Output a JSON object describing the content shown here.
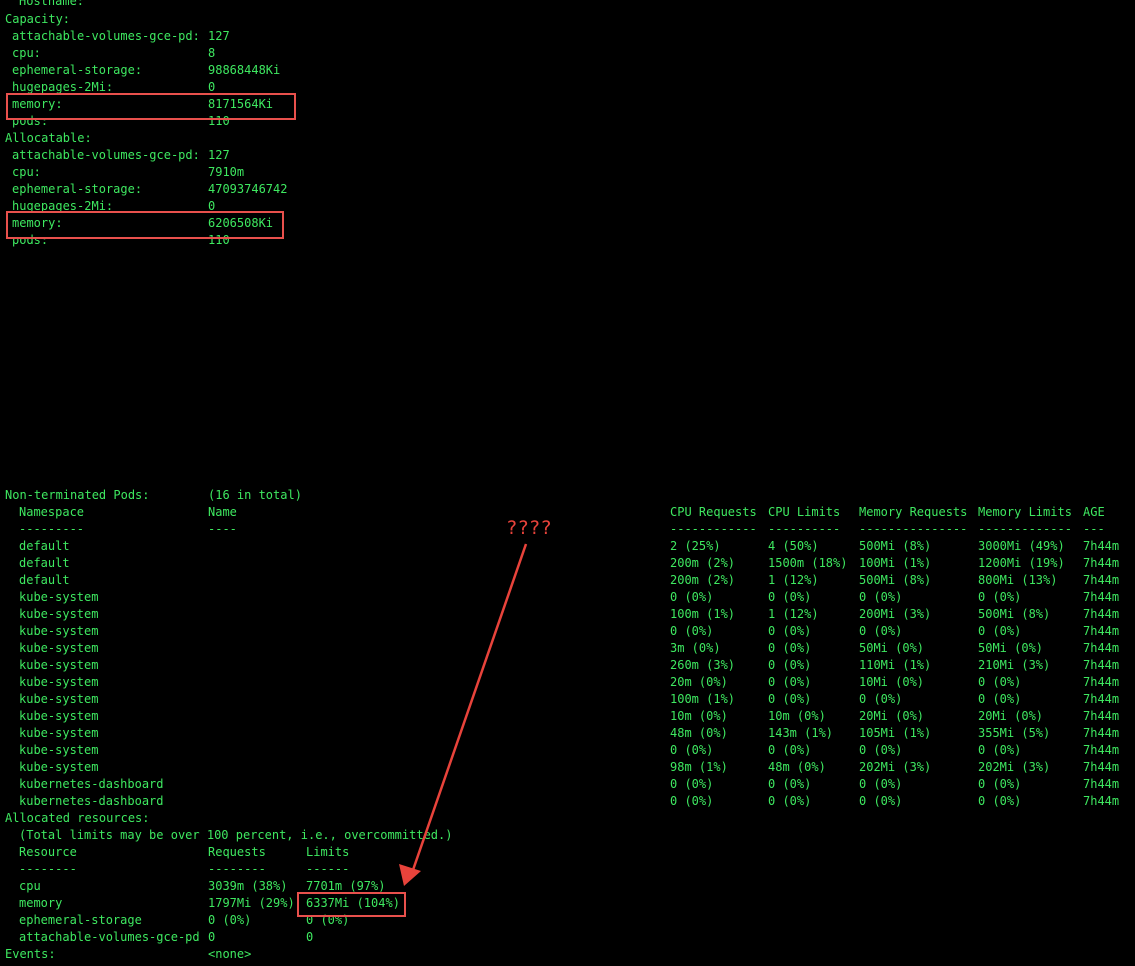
{
  "node": {
    "hostname_label": "Hostname:",
    "capacity": {
      "label": "Capacity:",
      "rows": [
        {
          "key": "attachable-volumes-gce-pd:",
          "value": "127"
        },
        {
          "key": "cpu:",
          "value": "8"
        },
        {
          "key": "ephemeral-storage:",
          "value": "98868448Ki"
        },
        {
          "key": "hugepages-2Mi:",
          "value": "0"
        },
        {
          "key": "memory:",
          "value": "8171564Ki"
        },
        {
          "key": "pods:",
          "value": "110"
        }
      ]
    },
    "allocatable": {
      "label": "Allocatable:",
      "rows": [
        {
          "key": "attachable-volumes-gce-pd:",
          "value": "127"
        },
        {
          "key": "cpu:",
          "value": "7910m"
        },
        {
          "key": "ephemeral-storage:",
          "value": "47093746742"
        },
        {
          "key": "hugepages-2Mi:",
          "value": "0"
        },
        {
          "key": "memory:",
          "value": "6206508Ki"
        },
        {
          "key": "pods:",
          "value": "110"
        }
      ]
    }
  },
  "pods": {
    "label": "Non-terminated Pods:",
    "total": "(16 in total)",
    "columns": {
      "namespace": "Namespace",
      "namespace_rule": "---------",
      "name": "Name",
      "name_rule": "----",
      "cpu_req": "CPU Requests",
      "cpu_req_rule": "------------",
      "cpu_lim": "CPU Limits",
      "cpu_lim_rule": "----------",
      "mem_req": "Memory Requests",
      "mem_req_rule": "---------------",
      "mem_lim": "Memory Limits",
      "mem_lim_rule": "-------------",
      "age": "AGE",
      "age_rule": "---"
    },
    "rows": [
      {
        "ns": "default",
        "cpu_req": "2 (25%)",
        "cpu_lim": "4 (50%)",
        "mem_req": "500Mi (8%)",
        "mem_lim": "3000Mi (49%)",
        "age": "7h44m"
      },
      {
        "ns": "default",
        "cpu_req": "200m (2%)",
        "cpu_lim": "1500m (18%)",
        "mem_req": "100Mi (1%)",
        "mem_lim": "1200Mi (19%)",
        "age": "7h44m"
      },
      {
        "ns": "default",
        "cpu_req": "200m (2%)",
        "cpu_lim": "1 (12%)",
        "mem_req": "500Mi (8%)",
        "mem_lim": "800Mi (13%)",
        "age": "7h44m"
      },
      {
        "ns": "kube-system",
        "cpu_req": "0 (0%)",
        "cpu_lim": "0 (0%)",
        "mem_req": "0 (0%)",
        "mem_lim": "0 (0%)",
        "age": "7h44m"
      },
      {
        "ns": "kube-system",
        "cpu_req": "100m (1%)",
        "cpu_lim": "1 (12%)",
        "mem_req": "200Mi (3%)",
        "mem_lim": "500Mi (8%)",
        "age": "7h44m"
      },
      {
        "ns": "kube-system",
        "cpu_req": "0 (0%)",
        "cpu_lim": "0 (0%)",
        "mem_req": "0 (0%)",
        "mem_lim": "0 (0%)",
        "age": "7h44m"
      },
      {
        "ns": "kube-system",
        "cpu_req": "3m (0%)",
        "cpu_lim": "0 (0%)",
        "mem_req": "50Mi (0%)",
        "mem_lim": "50Mi (0%)",
        "age": "7h44m"
      },
      {
        "ns": "kube-system",
        "cpu_req": "260m (3%)",
        "cpu_lim": "0 (0%)",
        "mem_req": "110Mi (1%)",
        "mem_lim": "210Mi (3%)",
        "age": "7h44m"
      },
      {
        "ns": "kube-system",
        "cpu_req": "20m (0%)",
        "cpu_lim": "0 (0%)",
        "mem_req": "10Mi (0%)",
        "mem_lim": "0 (0%)",
        "age": "7h44m"
      },
      {
        "ns": "kube-system",
        "cpu_req": "100m (1%)",
        "cpu_lim": "0 (0%)",
        "mem_req": "0 (0%)",
        "mem_lim": "0 (0%)",
        "age": "7h44m"
      },
      {
        "ns": "kube-system",
        "cpu_req": "10m (0%)",
        "cpu_lim": "10m (0%)",
        "mem_req": "20Mi (0%)",
        "mem_lim": "20Mi (0%)",
        "age": "7h44m"
      },
      {
        "ns": "kube-system",
        "cpu_req": "48m (0%)",
        "cpu_lim": "143m (1%)",
        "mem_req": "105Mi (1%)",
        "mem_lim": "355Mi (5%)",
        "age": "7h44m"
      },
      {
        "ns": "kube-system",
        "cpu_req": "0 (0%)",
        "cpu_lim": "0 (0%)",
        "mem_req": "0 (0%)",
        "mem_lim": "0 (0%)",
        "age": "7h44m"
      },
      {
        "ns": "kube-system",
        "cpu_req": "98m (1%)",
        "cpu_lim": "48m (0%)",
        "mem_req": "202Mi (3%)",
        "mem_lim": "202Mi (3%)",
        "age": "7h44m"
      },
      {
        "ns": "kubernetes-dashboard",
        "cpu_req": "0 (0%)",
        "cpu_lim": "0 (0%)",
        "mem_req": "0 (0%)",
        "mem_lim": "0 (0%)",
        "age": "7h44m"
      },
      {
        "ns": "kubernetes-dashboard",
        "cpu_req": "0 (0%)",
        "cpu_lim": "0 (0%)",
        "mem_req": "0 (0%)",
        "mem_lim": "0 (0%)",
        "age": "7h44m"
      }
    ]
  },
  "allocated": {
    "label": "Allocated resources:",
    "note": "(Total limits may be over 100 percent, i.e., overcommitted.)",
    "columns": {
      "resource": "Resource",
      "resource_rule": "--------",
      "requests": "Requests",
      "requests_rule": "--------",
      "limits": "Limits",
      "limits_rule": "------"
    },
    "rows": [
      {
        "resource": "cpu",
        "requests": "3039m (38%)",
        "limits": "7701m (97%)"
      },
      {
        "resource": "memory",
        "requests": "1797Mi (29%)",
        "limits": "6337Mi (104%)"
      },
      {
        "resource": "ephemeral-storage",
        "requests": "0 (0%)",
        "limits": "0 (0%)"
      },
      {
        "resource": "attachable-volumes-gce-pd",
        "requests": "0",
        "limits": "0"
      }
    ]
  },
  "events": {
    "label": "Events:",
    "value": "<none>"
  },
  "annotation": {
    "text": "????",
    "color": "#e8433b"
  },
  "colors": {
    "terminal_text": "#3ee860",
    "background": "#000000",
    "highlight": "#e8504c"
  }
}
